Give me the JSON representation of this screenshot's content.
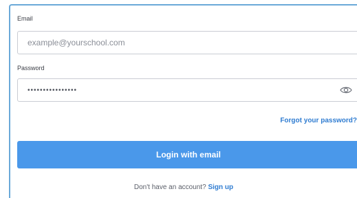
{
  "form": {
    "email_label": "Email",
    "email_placeholder": "example@yourschool.com",
    "password_label": "Password",
    "password_value": "••••••••••••••••",
    "forgot_link": "Forgot your password?",
    "login_button": "Login with email",
    "signup_prompt": "Don't have an account?",
    "signup_link": "Sign up"
  },
  "icons": {
    "show_password": "eye-icon"
  },
  "colors": {
    "primary": "#4a98ea",
    "link": "#2f7cd1",
    "card_border": "#6aa9d8",
    "field_border": "#c9ccd3"
  }
}
